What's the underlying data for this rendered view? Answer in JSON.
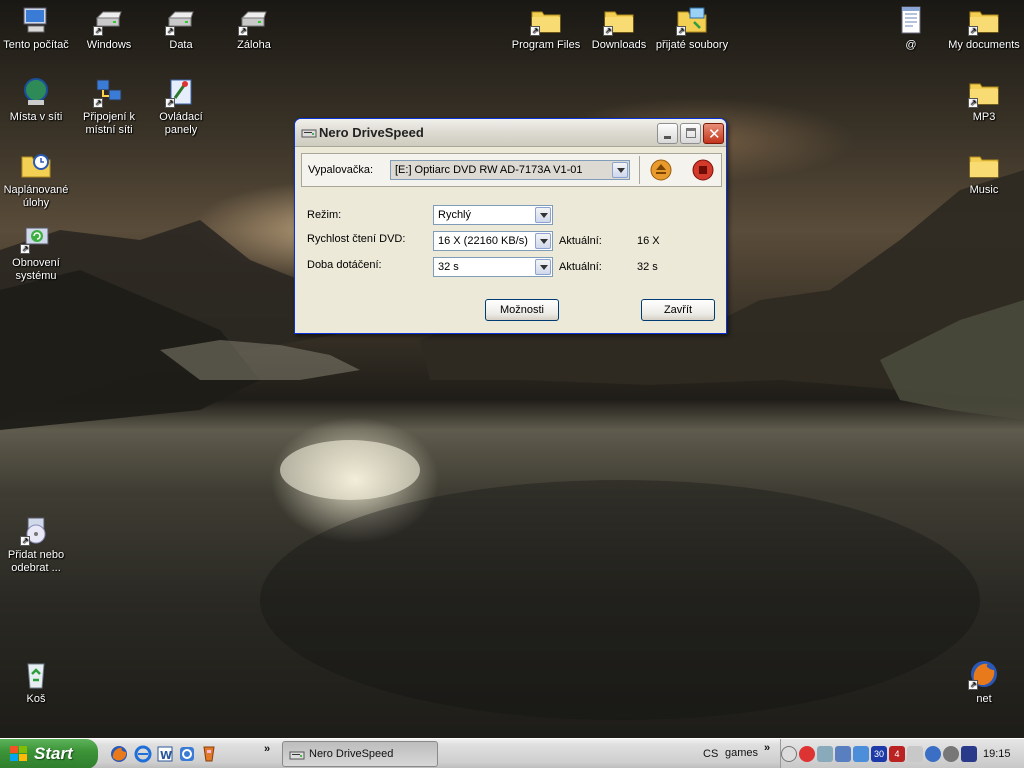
{
  "desktop": {
    "icons_left": [
      {
        "label": "Tento počítač",
        "icon": "my-computer-icon"
      },
      {
        "label": "Windows",
        "icon": "drive-icon"
      },
      {
        "label": "Data",
        "icon": "drive-icon"
      },
      {
        "label": "Záloha",
        "icon": "drive-icon"
      },
      {
        "label": "Místa v síti",
        "icon": "network-places-icon"
      },
      {
        "label": "Připojení k místní síti",
        "icon": "network-connection-icon"
      },
      {
        "label": "Ovládací panely",
        "icon": "control-panel-icon"
      },
      {
        "label": "Naplánované úlohy",
        "icon": "scheduled-tasks-icon"
      },
      {
        "label": "Obnovení systému",
        "icon": "system-restore-icon"
      },
      {
        "label": "Přidat nebo odebrat ...",
        "icon": "add-remove-programs-icon"
      },
      {
        "label": "Koš",
        "icon": "recycle-bin-icon"
      }
    ],
    "icons_right": [
      {
        "label": "Program Files",
        "icon": "folder-icon"
      },
      {
        "label": "Downloads",
        "icon": "folder-icon"
      },
      {
        "label": "přijaté soubory",
        "icon": "received-files-icon"
      },
      {
        "label": "@",
        "icon": "notepad-icon"
      },
      {
        "label": "My documents",
        "icon": "folder-icon"
      },
      {
        "label": "MP3",
        "icon": "folder-icon"
      },
      {
        "label": "Music",
        "icon": "folder-icon"
      },
      {
        "label": "net",
        "icon": "firefox-icon"
      }
    ]
  },
  "window": {
    "title": "Nero DriveSpeed",
    "recorder_label": "Vypalovačka:",
    "recorder_value": "[E:]  Optiarc DVD RW AD-7173A V1-01",
    "mode_label": "Režim:",
    "mode_value": "Rychlý",
    "read_speed_label": "Rychlost čtení DVD:",
    "read_speed_value": "16 X  (22160 KB/s)",
    "current_label_1": "Aktuální:",
    "current_value_1": "16 X",
    "spindown_label": "Doba dotáčení:",
    "spindown_value": "32 s",
    "current_label_2": "Aktuální:",
    "current_value_2": "32 s",
    "options_button": "Možnosti",
    "close_button": "Zavřít",
    "eject_icon": "eject-icon",
    "stop_icon": "stop-icon"
  },
  "taskbar": {
    "start_label": "Start",
    "quick_launch": [
      "firefox-icon",
      "internet-explorer-icon",
      "word-icon",
      "ie-alt-icon",
      "tool-icon"
    ],
    "chevron": "»",
    "task_label": "Nero DriveSpeed",
    "language": "CS",
    "toolbar_label": "games",
    "tray_chevron": "»",
    "tray_badges": [
      "30",
      "4"
    ],
    "clock": "19:15"
  }
}
